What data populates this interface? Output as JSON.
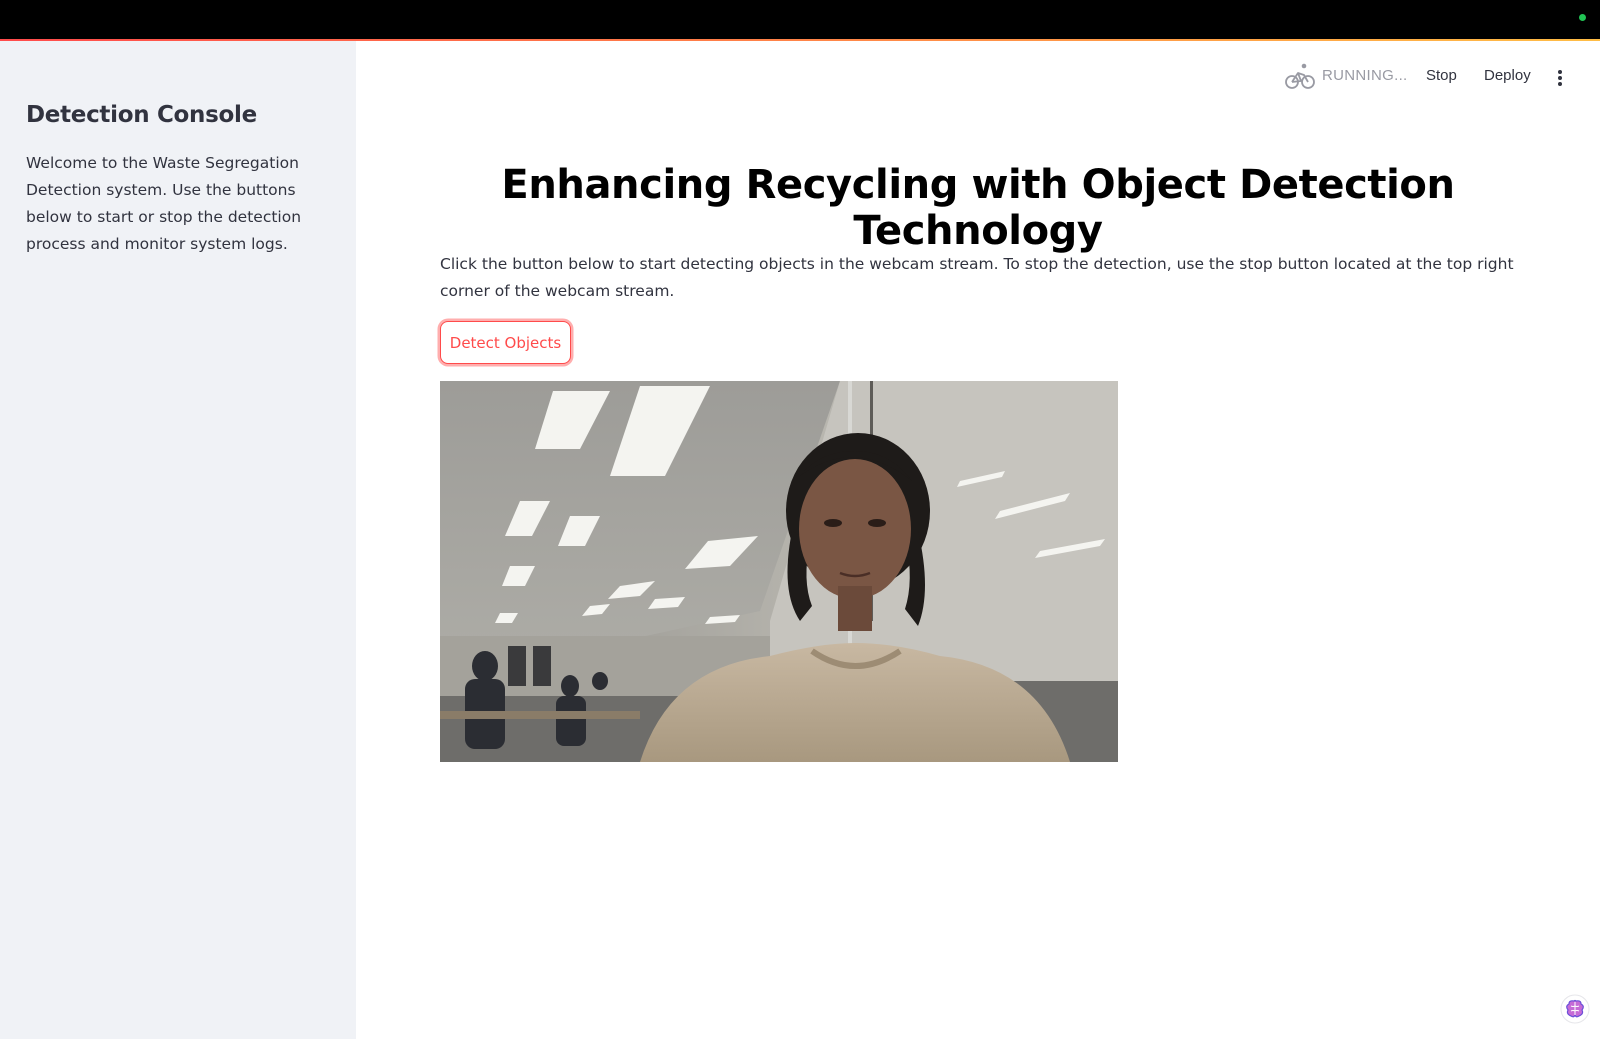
{
  "topbar": {
    "status_dot_color": "#21c354"
  },
  "sidebar": {
    "title": "Detection Console",
    "description": "Welcome to the Waste Segregation Detection system. Use the buttons below to start or stop the detection process and monitor system logs."
  },
  "header": {
    "status_icon": "running-man-bicycle-icon",
    "status_text": "RUNNING...",
    "stop_label": "Stop",
    "deploy_label": "Deploy",
    "menu_icon": "vertical-dots-menu-icon"
  },
  "main": {
    "title": "Enhancing Recycling with Object Detection Technology",
    "instructions": "Click the button below to start detecting objects in the webcam stream. To stop the detection, use the stop button located at the top right corner of the webcam stream.",
    "detect_button_label": "Detect Objects",
    "webcam_feed": "webcam-frame-image"
  },
  "colors": {
    "accent": "#ff4b4b",
    "sidebar_bg": "#f0f2f6",
    "text": "#31333f"
  },
  "footer": {
    "assistant_icon": "brain-icon"
  }
}
